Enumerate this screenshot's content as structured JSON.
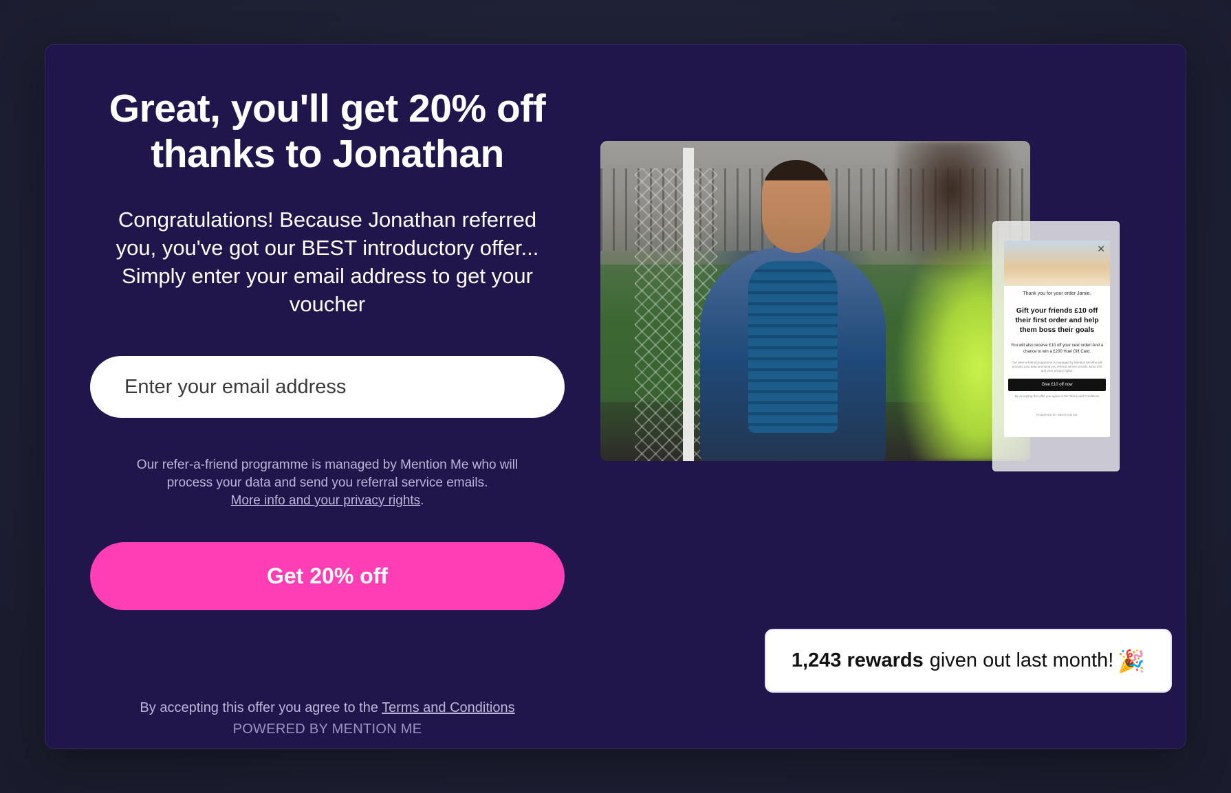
{
  "headline": "Great, you'll get 20% off thanks to Jonathan",
  "subtitle": "Congratulations! Because Jonathan referred you, you've got our BEST introductory offer... Simply enter your email address to get your voucher",
  "email": {
    "placeholder": "Enter your email address",
    "value": ""
  },
  "privacy": {
    "text": "Our refer-a-friend programme is managed by Mention Me who will process your data and send you referral service emails.",
    "link": "More info and your privacy rights",
    "suffix": "."
  },
  "cta_label": "Get 20% off",
  "footer": {
    "terms_prefix": "By accepting this offer you agree to the",
    "terms_link": "Terms and Conditions",
    "powered_by": "POWERED BY MENTION ME"
  },
  "preview_card": {
    "thanks": "Thank you for your order Jamie.",
    "headline": "Gift your friends £10 off their first order and help them boss their goals",
    "body": "You will also receive £10 off your next order! And a chance to win a £200 Huel Gift Card.",
    "fine_print": "Our refer-a-friend programme is managed by Mention Me who will process your data and send you referral service emails. More info and your privacy rights.",
    "button": "Give £10 off now",
    "terms": "By accepting this offer you agree to the Terms and Conditions",
    "powered_by": "POWERED BY MENTION ME"
  },
  "stats": {
    "count": "1,243 rewards",
    "text": "given out last month!",
    "emoji": "🎉"
  },
  "colors": {
    "card_background": "#20164c",
    "cta": "#ff3db4",
    "page_background": "#1d1f33"
  }
}
